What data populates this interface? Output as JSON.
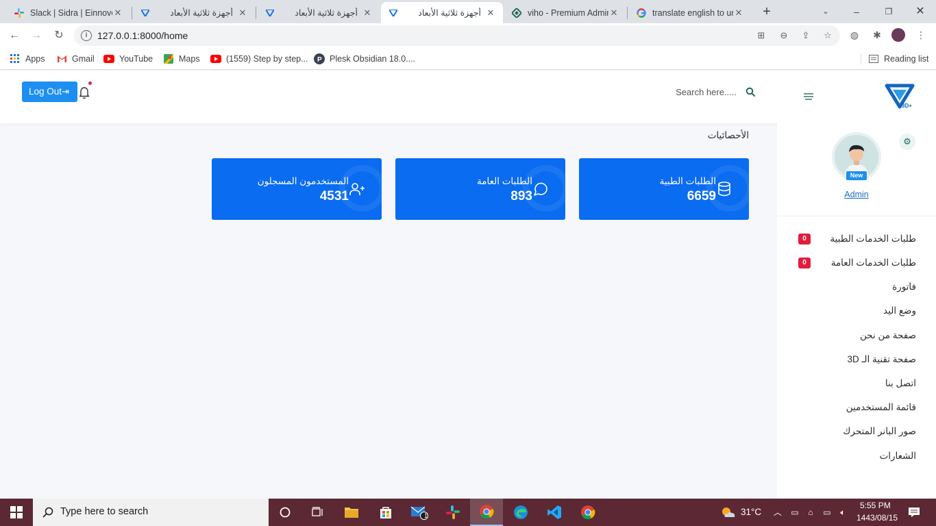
{
  "browser": {
    "tabs": [
      {
        "title": "Slack | Sidra | Einnovention",
        "favicon": "slack-icon",
        "active": false
      },
      {
        "title": "أجهزة ثلاثية الأبعاد",
        "favicon": "v3d-logo-icon",
        "active": false
      },
      {
        "title": "أجهزة ثلاثية الأبعاد",
        "favicon": "v3d-logo-icon",
        "active": false
      },
      {
        "title": "أجهزة ثلاثية الأبعاد",
        "favicon": "v3d-logo-icon",
        "active": true
      },
      {
        "title": "viho - Premium Admin Template",
        "favicon": "viho-icon",
        "active": false
      },
      {
        "title": "translate english to urdu",
        "favicon": "google-icon",
        "active": false
      }
    ],
    "url": "127.0.0.1:8000/home",
    "bookmarks": [
      {
        "label": "Apps",
        "icon": "apps-grid-icon"
      },
      {
        "label": "Gmail",
        "icon": "gmail-icon"
      },
      {
        "label": "YouTube",
        "icon": "youtube-icon"
      },
      {
        "label": "Maps",
        "icon": "maps-icon"
      },
      {
        "label": "(1559) Step by step...",
        "icon": "youtube-icon"
      },
      {
        "label": "Plesk Obsidian 18.0....",
        "icon": "plesk-icon"
      }
    ],
    "reading_list": "Reading list"
  },
  "header": {
    "logout_label": "Log Out",
    "search_placeholder": "Search here.....",
    "logo_text": "3D+"
  },
  "sidebar": {
    "badge_new": "New",
    "profile_name": "Admin",
    "menu": [
      {
        "label": "طلبات الخدمات الطبية",
        "badge": "0"
      },
      {
        "label": "طلبات الخدمات العامة",
        "badge": "0"
      },
      {
        "label": "فاتورة",
        "badge": null
      },
      {
        "label": "وضع اليد",
        "badge": null
      },
      {
        "label": "صفحة من نحن",
        "badge": null
      },
      {
        "label": "صفحة تقنية الـ 3D",
        "badge": null
      },
      {
        "label": "اتصل بنا",
        "badge": null
      },
      {
        "label": "قائمة المستخدمين",
        "badge": null
      },
      {
        "label": "صور البانر المتحرك",
        "badge": null
      },
      {
        "label": "الشعارات",
        "badge": null
      }
    ]
  },
  "main": {
    "section_title": "الأحصائيات",
    "cards": [
      {
        "label": "الطلبات الطبية",
        "value": "6659",
        "icon": "database-icon"
      },
      {
        "label": "الطلبات العامة",
        "value": "893",
        "icon": "chat-bubble-icon"
      },
      {
        "label": "المستخدمون المسجلون",
        "value": "4531",
        "icon": "user-plus-icon"
      }
    ]
  },
  "taskbar": {
    "search_placeholder": "Type here to search",
    "temperature": "31°C",
    "time": "5:55 PM",
    "date": "1443/08/15",
    "mail_count": "1"
  },
  "colors": {
    "accent": "#0a6cf0",
    "logout_button": "#1d8ff2",
    "badge_red": "#e11d3c",
    "theme_green": "#24695c",
    "taskbar": "#5b2833"
  }
}
